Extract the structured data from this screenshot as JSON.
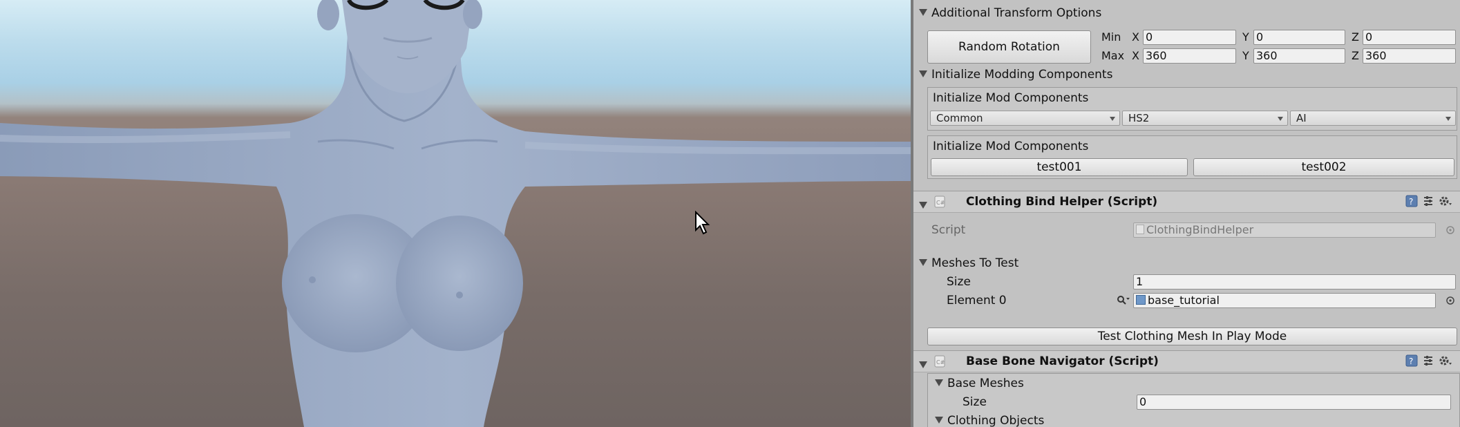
{
  "inspector": {
    "additional_transform": {
      "title": "Additional Transform Options",
      "random_rotation_label": "Random Rotation",
      "min_label": "Min",
      "max_label": "Max",
      "x_label": "X",
      "y_label": "Y",
      "z_label": "Z",
      "min": {
        "x": "0",
        "y": "0",
        "z": "0"
      },
      "max": {
        "x": "360",
        "y": "360",
        "z": "360"
      }
    },
    "init_modding": {
      "title": "Initialize Modding Components",
      "box1_title": "Initialize Mod Components",
      "dropdowns": [
        "Common",
        "HS2",
        "AI"
      ],
      "box2_title": "Initialize Mod Components",
      "buttons": [
        "test001",
        "test002"
      ]
    },
    "clothing_bind": {
      "title": "Clothing Bind Helper (Script)",
      "script_label": "Script",
      "script_value": "ClothingBindHelper",
      "meshes_title": "Meshes To Test",
      "size_label": "Size",
      "size_value": "1",
      "element_label": "Element 0",
      "element_value": "base_tutorial",
      "test_button": "Test Clothing Mesh In Play Mode"
    },
    "base_bone": {
      "title": "Base Bone Navigator (Script)",
      "base_meshes_title": "Base Meshes",
      "size_label": "Size",
      "size_value": "0",
      "clothing_objects_title": "Clothing Objects"
    }
  },
  "icons": {
    "component": "script-component-icon",
    "help": "help-icon",
    "preset": "preset-icon",
    "settings": "gear-icon",
    "picker": "object-picker-icon",
    "search": "search-icon",
    "cursor": "mouse-cursor-icon"
  },
  "colors": {
    "panel_bg": "#c2c2c2",
    "sky": "#bcdcec",
    "ground": "#7a6d69",
    "model": "#9aaac3"
  }
}
